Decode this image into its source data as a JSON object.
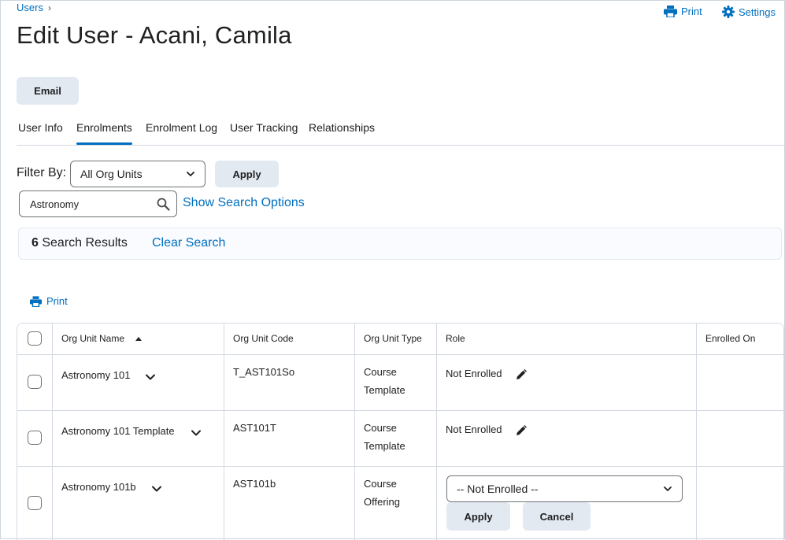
{
  "breadcrumb": {
    "parent": "Users",
    "separator": "›"
  },
  "page_title": "Edit User - Acani, Camila",
  "top_actions": {
    "print": "Print",
    "settings": "Settings"
  },
  "email_button": "Email",
  "tabs": [
    "User Info",
    "Enrolments",
    "Enrolment Log",
    "User Tracking",
    "Relationships"
  ],
  "active_tab": "Enrolments",
  "filter": {
    "label": "Filter By:",
    "selected": "All Org Units",
    "apply": "Apply"
  },
  "search": {
    "value": "Astronomy",
    "show_options": "Show Search Options"
  },
  "results": {
    "count": "6",
    "label": "Search Results",
    "clear": "Clear Search"
  },
  "print_link": "Print",
  "table": {
    "headers": [
      "Org Unit Name",
      "Org Unit Code",
      "Org Unit Type",
      "Role",
      "Enrolled On"
    ],
    "sort_indicator": "ascending",
    "rows": [
      {
        "name": "Astronomy 101",
        "code": "T_AST101So",
        "type_line1": "Course",
        "type_line2": "Template",
        "role": "Not Enrolled"
      },
      {
        "name": "Astronomy 101 Template",
        "code": "AST101T",
        "type_line1": "Course",
        "type_line2": "Template",
        "role": "Not Enrolled"
      },
      {
        "name": "Astronomy 101b",
        "code": "AST101b",
        "type_line1": "Course",
        "type_line2": "Offering",
        "role_select": "-- Not Enrolled --",
        "apply": "Apply",
        "cancel": "Cancel"
      }
    ]
  },
  "colors": {
    "link": "#006fbf",
    "button_bg": "#e3e9f1",
    "border": "#d3d9e3",
    "text": "#202122"
  },
  "icons": {
    "print": "printer-icon",
    "settings": "gear-icon",
    "search": "magnifier-icon",
    "edit": "pencil-icon",
    "expand": "chevron-down-icon",
    "sort": "sort-up-icon"
  }
}
